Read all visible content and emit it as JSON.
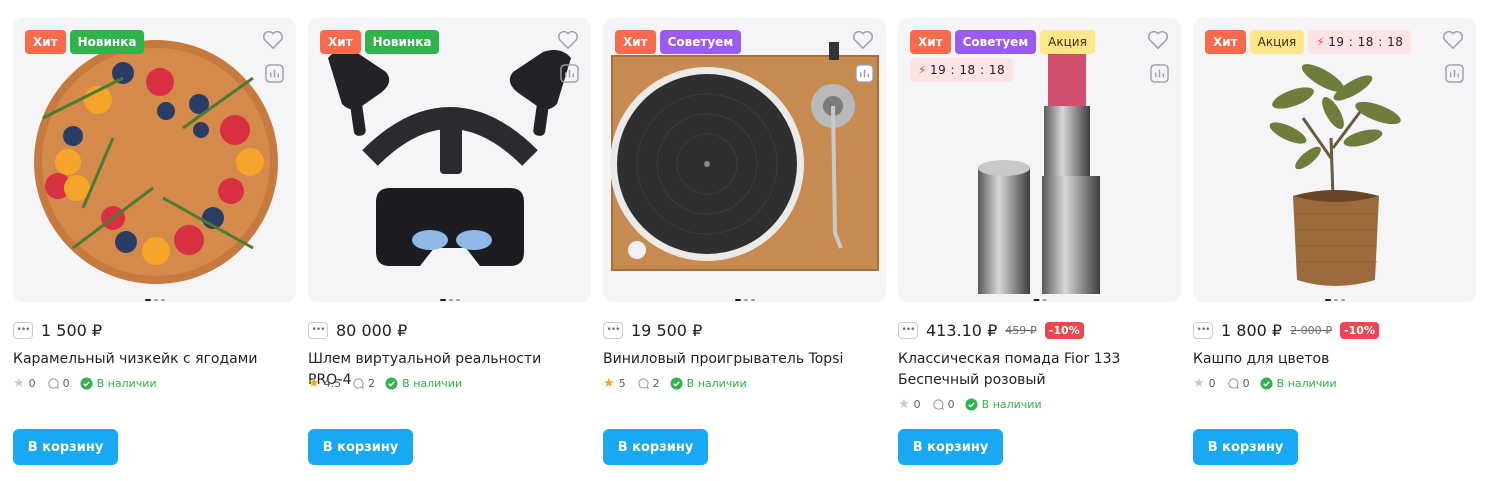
{
  "colors": {
    "accent": "#18a9f2",
    "hit": "#f86a4c",
    "new": "#2fb34b",
    "advice": "#9c5af0",
    "promo": "#fde68c",
    "discount": "#f04452"
  },
  "cart_label": "В корзину",
  "availability": "В наличии",
  "products": [
    {
      "badges": [
        "Хит",
        "Новинка"
      ],
      "timer": "",
      "price": "1 500 ₽",
      "old_price": "",
      "discount": "",
      "title": "Карамельный чизкейк с ягодами",
      "rating": "0",
      "comments": "0"
    },
    {
      "badges": [
        "Хит",
        "Новинка"
      ],
      "timer": "",
      "price": "80 000 ₽",
      "old_price": "",
      "discount": "",
      "title": "Шлем виртуальной реальности PRO-4",
      "rating": "4.5",
      "comments": "2"
    },
    {
      "badges": [
        "Хит",
        "Советуем"
      ],
      "timer": "",
      "price": "19 500 ₽",
      "old_price": "",
      "discount": "",
      "title": "Виниловый проигрыватель Topsi",
      "rating": "5",
      "comments": "2"
    },
    {
      "badges": [
        "Хит",
        "Советуем",
        "Акция"
      ],
      "timer": "19 : 18 : 18",
      "price": "413.10 ₽",
      "old_price": "459 ₽",
      "discount": "-10%",
      "title": "Классическая помада Fior 133 Беспечный розовый",
      "rating": "0",
      "comments": "0"
    },
    {
      "badges": [
        "Хит",
        "Акция"
      ],
      "timer": "19 : 18 : 18",
      "price": "1 800 ₽",
      "old_price": "2 000 ₽",
      "discount": "-10%",
      "title": "Кашпо для цветов",
      "rating": "0",
      "comments": "0"
    }
  ]
}
